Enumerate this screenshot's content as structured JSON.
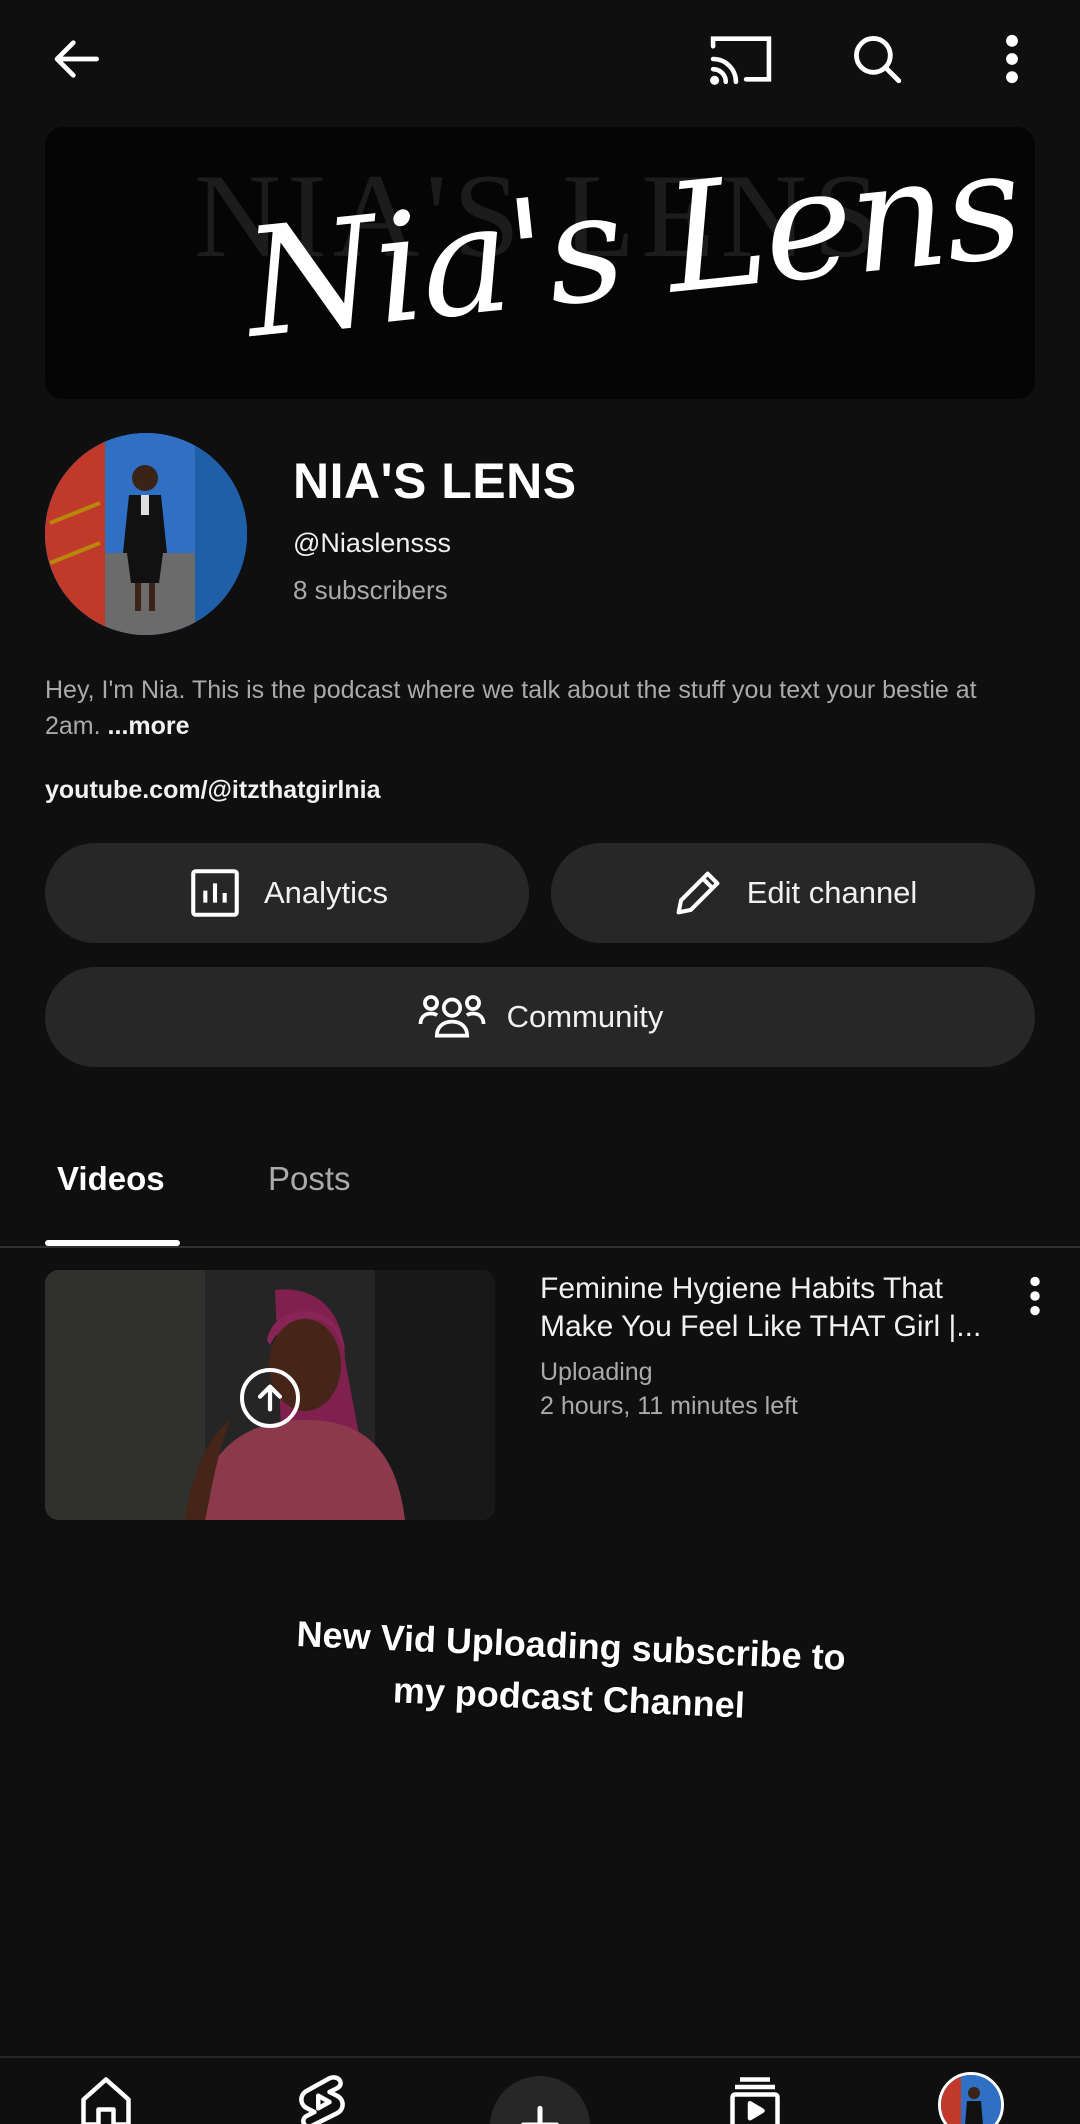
{
  "banner": {
    "bg_text": "NIA'S LENS",
    "script_text": "Nia's Lens"
  },
  "channel": {
    "name": "NIA'S LENS",
    "handle": "@Niaslensss",
    "subscribers": "8 subscribers",
    "description": "Hey, I'm Nia. This is the podcast where we talk about the stuff you text your bestie at 2am.",
    "more_label": "...more",
    "link": "youtube.com/@itzthatgirlnia"
  },
  "actions": {
    "analytics_label": "Analytics",
    "edit_label": "Edit channel",
    "community_label": "Community"
  },
  "tabs": [
    {
      "label": "Videos",
      "active": true
    },
    {
      "label": "Posts",
      "active": false
    }
  ],
  "video": {
    "title": "Feminine Hygiene Habits That Make You Feel Like THAT Girl |...",
    "status": "Uploading",
    "time_left": "2 hours, 11 minutes left"
  },
  "overlay_caption": "New Vid Uploading subscribe to my podcast Channel",
  "icons": {
    "back": "arrow-left-icon",
    "cast": "cast-icon",
    "search": "search-icon",
    "more": "more-vert-icon",
    "analytics": "bar-chart-icon",
    "edit": "pencil-icon",
    "community": "people-icon",
    "upload": "upload-arrow-icon",
    "home": "home-icon",
    "shorts": "shorts-icon",
    "create": "plus-icon",
    "subscriptions": "subscriptions-icon"
  },
  "colors": {
    "background": "#0f0f0f",
    "pill": "#272727",
    "secondary_text": "#aaaaaa",
    "primary_text": "#f1f1f1"
  }
}
